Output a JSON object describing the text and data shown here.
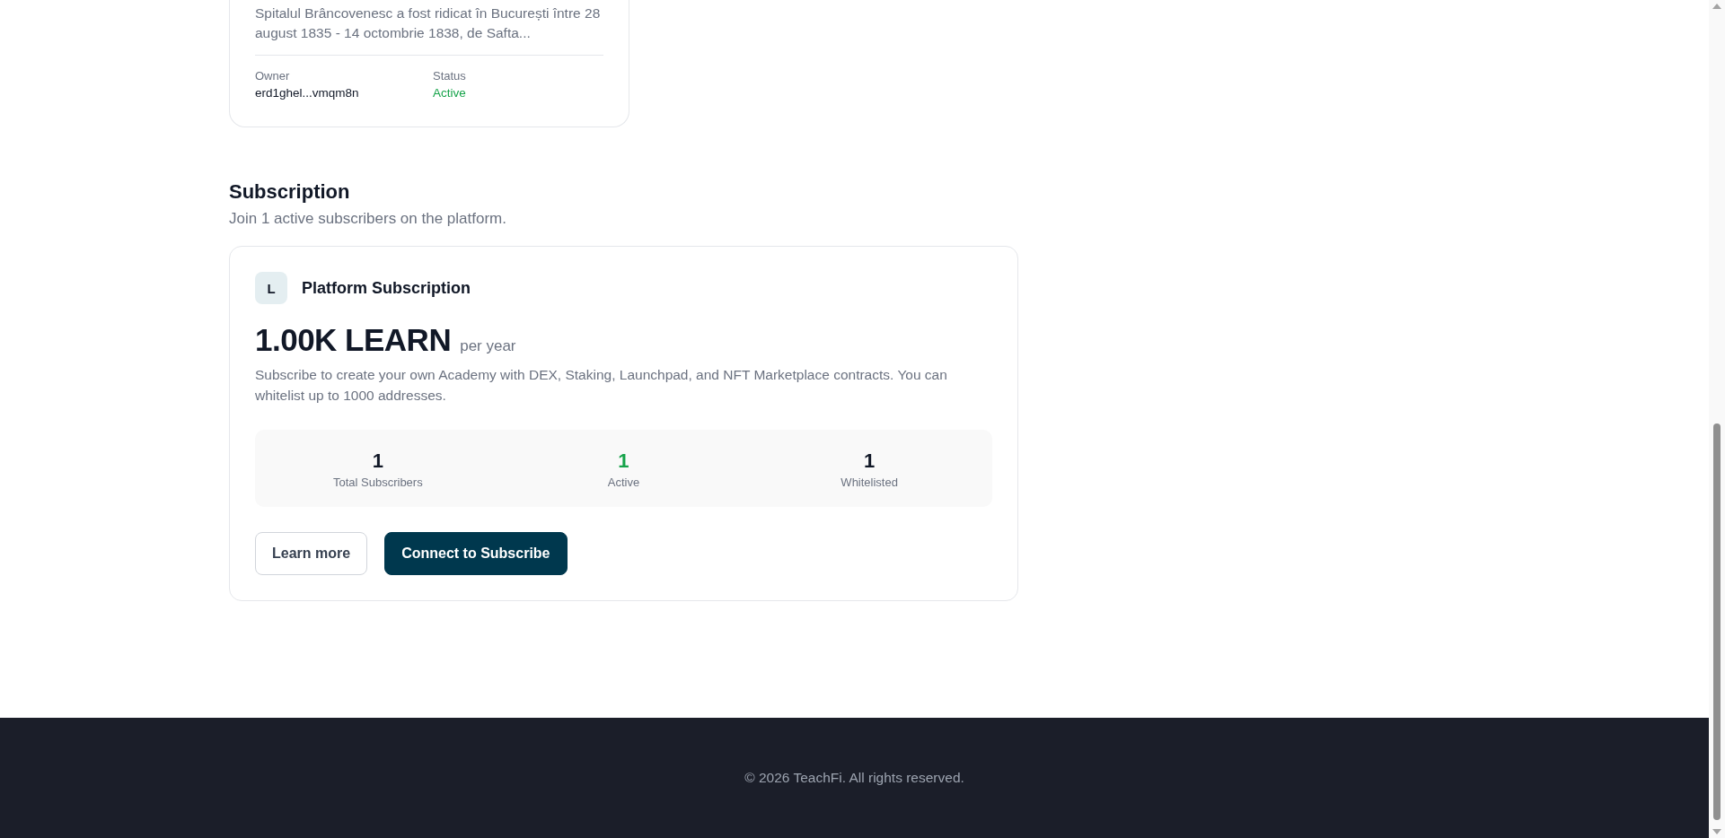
{
  "project_card": {
    "description": "Spitalul Brâncovenesc a fost ridicat în București între 28 august 1835 - 14 octombrie 1838, de Safta...",
    "owner": {
      "label": "Owner",
      "value": "erd1ghel...vmqm8n"
    },
    "status": {
      "label": "Status",
      "value": "Active",
      "kind": "active"
    }
  },
  "subscription": {
    "title": "Subscription",
    "subtitle": "Join 1 active subscribers on the platform.",
    "plan": {
      "initial": "L",
      "name": "Platform Subscription",
      "price": "1.00K LEARN",
      "period": "per year",
      "description": "Subscribe to create your own Academy with DEX, Staking, Launchpad, and NFT Marketplace contracts. You can whitelist up to 1000 addresses.",
      "stats": [
        {
          "value": "1",
          "label": "Total Subscribers",
          "kind": "neutral"
        },
        {
          "value": "1",
          "label": "Active",
          "kind": "positive"
        },
        {
          "value": "1",
          "label": "Whitelisted",
          "kind": "neutral"
        }
      ],
      "buttons": [
        {
          "label": "Learn more",
          "kind": "secondary"
        },
        {
          "label": "Connect to Subscribe",
          "kind": "primary"
        }
      ]
    }
  },
  "footer": {
    "copyright": "© 2026 TeachFi. All rights reserved."
  }
}
